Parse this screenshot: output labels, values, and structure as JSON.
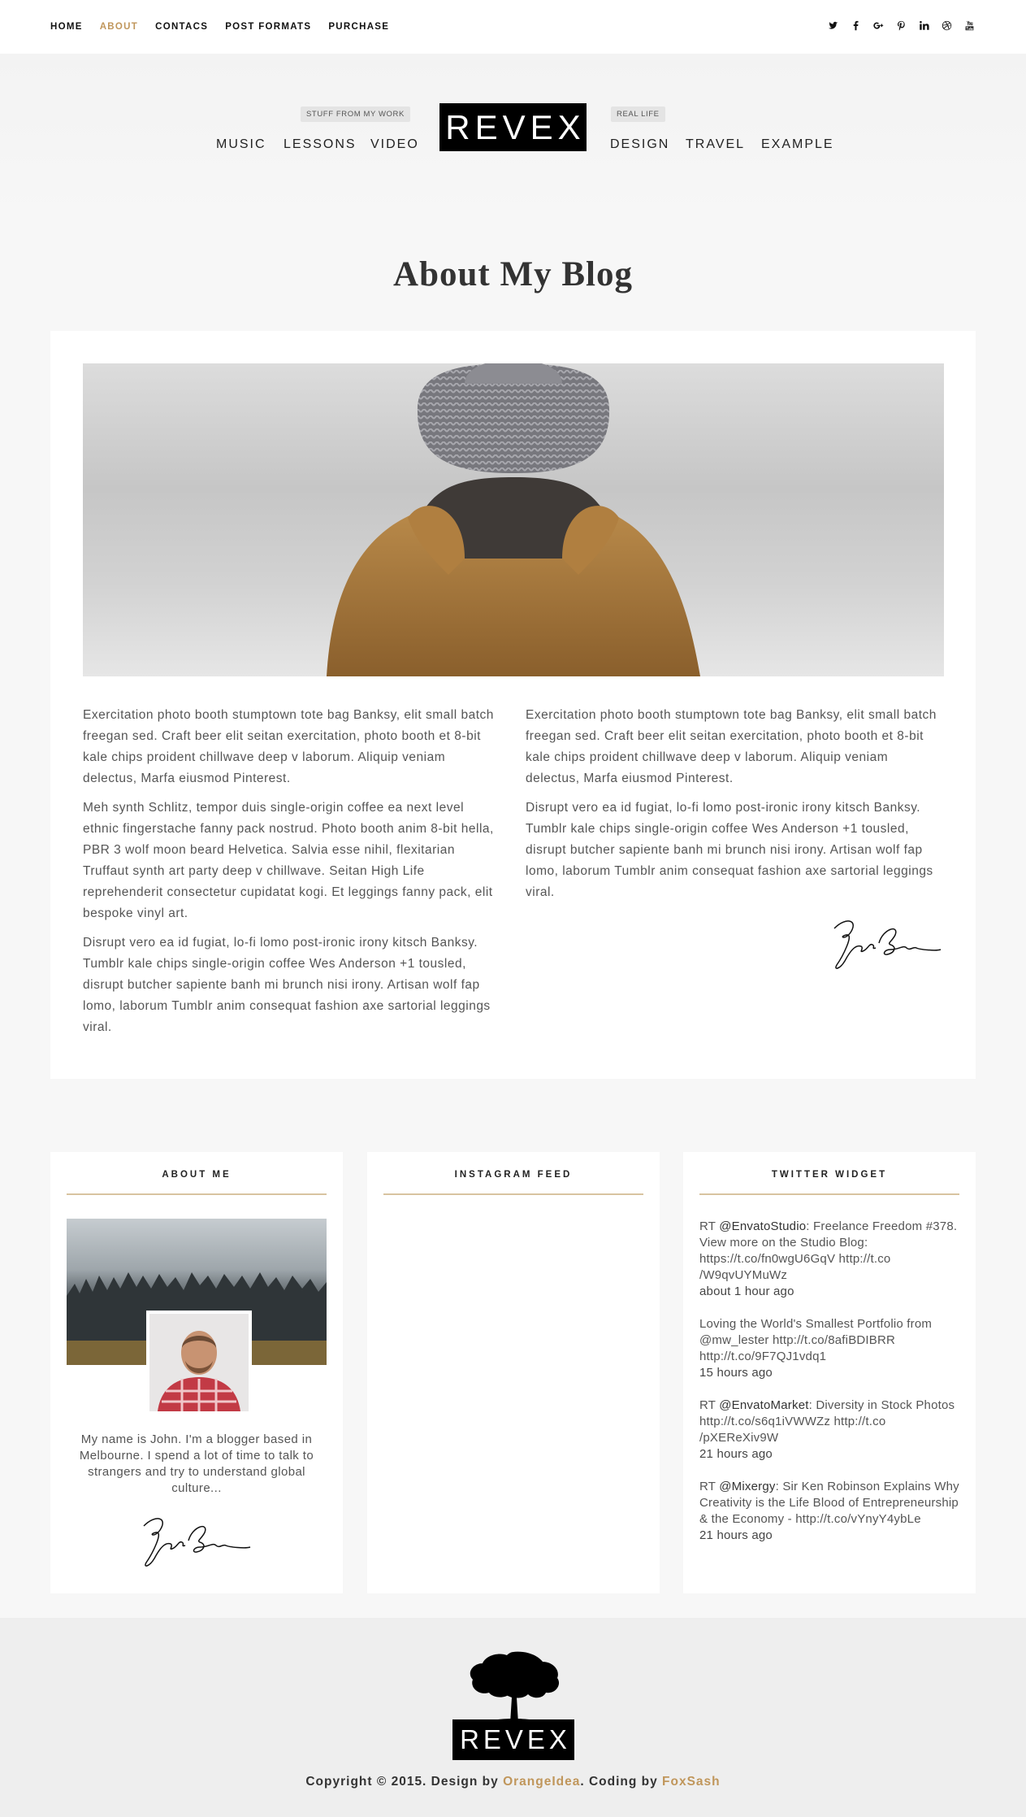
{
  "topnav": {
    "items": [
      "HOME",
      "ABOUT",
      "CONTACS",
      "POST FORMATS",
      "PURCHASE"
    ]
  },
  "social_icons": [
    "twitter-icon",
    "facebook-icon",
    "google-plus-icon",
    "pinterest-icon",
    "linkedin-icon",
    "dribbble-icon",
    "youtube-icon"
  ],
  "header": {
    "tag_left": "STUFF FROM MY WORK",
    "tag_right": "REAL LIFE",
    "logo": "REVEX",
    "nav_left": [
      "MUSIC",
      "LESSONS",
      "VIDEO"
    ],
    "nav_right": [
      "DESIGN",
      "TRAVEL",
      "EXAMPLE"
    ]
  },
  "page": {
    "title": "About My Blog"
  },
  "content": {
    "left": [
      "Exercitation photo booth stumptown tote bag Banksy, elit small batch freegan sed. Craft beer elit seitan exercitation, photo booth et 8-bit kale chips proident chillwave deep v laborum. Aliquip veniam delectus, Marfa eiusmod Pinterest.",
      "Meh synth Schlitz, tempor duis single-origin coffee ea next level ethnic fingerstache fanny pack nostrud. Photo booth anim 8-bit hella, PBR 3 wolf moon beard Helvetica. Salvia esse nihil, flexitarian Truffaut synth art party deep v chillwave. Seitan High Life reprehenderit consectetur cupidatat kogi. Et leggings fanny pack, elit bespoke vinyl art.",
      "Disrupt vero ea id fugiat, lo-fi lomo post-ironic irony kitsch Banksy. Tumblr kale chips single-origin coffee Wes Anderson +1 tousled, disrupt butcher sapiente banh mi brunch nisi irony. Artisan wolf fap lomo, laborum Tumblr anim consequat fashion axe sartorial leggings viral."
    ],
    "right": [
      "Exercitation photo booth stumptown tote bag Banksy, elit small batch freegan sed. Craft beer elit seitan exercitation, photo booth et 8-bit kale chips proident chillwave deep v laborum. Aliquip veniam delectus, Marfa eiusmod Pinterest.",
      "Disrupt vero ea id fugiat, lo-fi lomo post-ironic irony kitsch Banksy. Tumblr kale chips single-origin coffee Wes Anderson +1 tousled, disrupt butcher sapiente banh mi brunch nisi irony. Artisan wolf fap lomo, laborum Tumblr anim consequat fashion axe sartorial leggings viral."
    ]
  },
  "widgets": {
    "about": {
      "title": "ABOUT ME",
      "text": "My name is John. I'm a blogger based in Melbourne. I spend a lot of time to talk to strangers and try to understand global culture..."
    },
    "instagram": {
      "title": "INSTAGRAM FEED"
    },
    "twitter": {
      "title": "TWITTER WIDGET",
      "tweets": [
        {
          "prefix": "RT ",
          "author": "@EnvatoStudio",
          "text": ": Freelance Freedom #378. View more on the Studio Blog: https://t.co/fn0wgU6GqV http://t.co /W9qvUYMuWz",
          "time": "about 1 hour ago"
        },
        {
          "prefix": "",
          "author": "",
          "text": "Loving the World's Smallest Portfolio from @mw_lester http://t.co/8afiBDIBRR http://t.co/9F7QJ1vdq1",
          "time": "15 hours ago"
        },
        {
          "prefix": "RT ",
          "author": "@EnvatoMarket",
          "text": ": Diversity in Stock Photos http://t.co/s6q1iVWWZz http://t.co /pXEReXiv9W",
          "time": "21 hours ago"
        },
        {
          "prefix": "RT ",
          "author": "@Mixergy",
          "text": ": Sir Ken Robinson Explains Why Creativity is the Life Blood of Entrepreneurship & the Economy - http://t.co/vYnyY4ybLe",
          "time": "21 hours ago"
        }
      ]
    }
  },
  "footer": {
    "logo": "REVEX",
    "copy_prefix": "Copyright © 2015. Design by ",
    "design_by": "OrangeIdea",
    "copy_mid": ". Coding by ",
    "coding_by": "FoxSash"
  },
  "colors": {
    "accent": "#c0965b",
    "rule": "#d8c3a0",
    "logo_bg": "#000000"
  }
}
